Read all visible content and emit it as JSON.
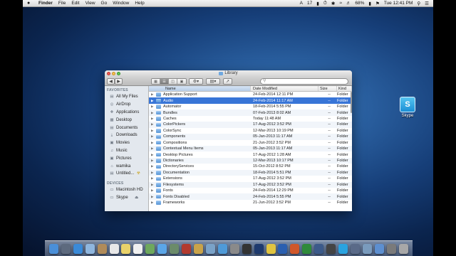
{
  "menubar": {
    "apple": "",
    "app_name": "Finder",
    "menus": [
      "File",
      "Edit",
      "View",
      "Go",
      "Window",
      "Help"
    ],
    "status": {
      "ai": "A",
      "number": "17",
      "battery": "68%",
      "clock": "Tue 12:41 PM"
    }
  },
  "window": {
    "title": "Library",
    "search_placeholder": ""
  },
  "sidebar": {
    "favorites_header": "FAVORITES",
    "favorites": [
      {
        "label": "All My Files",
        "icon": "all-files-icon"
      },
      {
        "label": "AirDrop",
        "icon": "airdrop-icon"
      },
      {
        "label": "Applications",
        "icon": "applications-icon"
      },
      {
        "label": "Desktop",
        "icon": "desktop-icon"
      },
      {
        "label": "Documents",
        "icon": "documents-icon"
      },
      {
        "label": "Downloads",
        "icon": "downloads-icon"
      },
      {
        "label": "Movies",
        "icon": "movies-icon"
      },
      {
        "label": "Music",
        "icon": "music-icon"
      },
      {
        "label": "Pictures",
        "icon": "pictures-icon"
      },
      {
        "label": "wamika",
        "icon": "home-icon"
      },
      {
        "label": "Untitled...",
        "icon": "folder-icon"
      }
    ],
    "devices_header": "DEVICES",
    "devices": [
      {
        "label": "Macintosh HD",
        "icon": "harddisk-icon"
      },
      {
        "label": "Skype",
        "icon": "disk-icon"
      }
    ]
  },
  "list": {
    "columns": {
      "name": "Name",
      "date": "Date Modified",
      "size": "Size",
      "kind": "Kind"
    },
    "rows": [
      {
        "name": "Application Support",
        "date": "24-Feb-2014 12:11 PM",
        "size": "--",
        "kind": "Folder"
      },
      {
        "name": "Audio",
        "date": "24-Feb-2014 11:17 AM",
        "size": "--",
        "kind": "Folder"
      },
      {
        "name": "Automator",
        "date": "18-Feb-2014 5:55 PM",
        "size": "--",
        "kind": "Folder"
      },
      {
        "name": "Bundles",
        "date": "07-Feb-2013 8:02 AM",
        "size": "--",
        "kind": "Folder"
      },
      {
        "name": "Caches",
        "date": "Today 11:48 AM",
        "size": "--",
        "kind": "Folder"
      },
      {
        "name": "ColorPickers",
        "date": "17-Aug-2012 3:52 PM",
        "size": "--",
        "kind": "Folder"
      },
      {
        "name": "ColorSync",
        "date": "12-Mar-2013 10:19 PM",
        "size": "--",
        "kind": "Folder"
      },
      {
        "name": "Components",
        "date": "05-Jan-2013 11:17 AM",
        "size": "--",
        "kind": "Folder"
      },
      {
        "name": "Compositions",
        "date": "21-Jun-2012 3:52 PM",
        "size": "--",
        "kind": "Folder"
      },
      {
        "name": "Contextual Menu Items",
        "date": "05-Jan-2013 11:17 AM",
        "size": "--",
        "kind": "Folder"
      },
      {
        "name": "Desktop Pictures",
        "date": "17-Aug-2012 1:28 AM",
        "size": "--",
        "kind": "Folder"
      },
      {
        "name": "Dictionaries",
        "date": "12-Mar-2013 10:17 PM",
        "size": "--",
        "kind": "Folder"
      },
      {
        "name": "DirectoryServices",
        "date": "15-Oct-2012 8:52 PM",
        "size": "--",
        "kind": "Folder"
      },
      {
        "name": "Documentation",
        "date": "18-Feb-2014 5:51 PM",
        "size": "--",
        "kind": "Folder"
      },
      {
        "name": "Extensions",
        "date": "17-Aug-2012 3:52 PM",
        "size": "--",
        "kind": "Folder"
      },
      {
        "name": "Filesystems",
        "date": "17-Aug-2012 3:52 PM",
        "size": "--",
        "kind": "Folder"
      },
      {
        "name": "Fonts",
        "date": "24-Feb-2014 12:29 PM",
        "size": "--",
        "kind": "Folder"
      },
      {
        "name": "Fonts Disabled",
        "date": "24-Feb-2014 5:55 PM",
        "size": "--",
        "kind": "Folder"
      },
      {
        "name": "Frameworks",
        "date": "21-Jun-2012 3:52 PM",
        "size": "--",
        "kind": "Folder"
      }
    ],
    "selected_index": 1
  },
  "desktop_icon": {
    "label": "Skype",
    "glyph": "S"
  },
  "dock": [
    {
      "icon": "finder-icon",
      "color": "#4a8fd8"
    },
    {
      "icon": "launchpad-icon",
      "color": "#5d6a7e"
    },
    {
      "icon": "safari-icon",
      "color": "#3a8ad8"
    },
    {
      "icon": "mail-icon",
      "color": "#8fb6de"
    },
    {
      "icon": "contacts-icon",
      "color": "#b08b5a"
    },
    {
      "icon": "calendar-icon",
      "color": "#e8e8e8"
    },
    {
      "icon": "notes-icon",
      "color": "#e9d26a"
    },
    {
      "icon": "reminders-icon",
      "color": "#f0f0f0"
    },
    {
      "icon": "maps-icon",
      "color": "#6ea85d"
    },
    {
      "icon": "messages-icon",
      "color": "#5ba6e8"
    },
    {
      "icon": "facetime-icon",
      "color": "#6b8b6a"
    },
    {
      "icon": "photo-booth-icon",
      "color": "#b23a2f"
    },
    {
      "icon": "itunes-icon",
      "color": "#c9a34a"
    },
    {
      "icon": "iphoto-icon",
      "color": "#7aa2c8"
    },
    {
      "icon": "app-store-icon",
      "color": "#4f9ad8"
    },
    {
      "icon": "system-preferences-icon",
      "color": "#8a8a8a"
    },
    {
      "icon": "dvd-player-icon",
      "color": "#333333"
    },
    {
      "icon": "photoshop-icon",
      "color": "#1e3a6e"
    },
    {
      "icon": "chrome-icon",
      "color": "#e0c440"
    },
    {
      "icon": "word-icon",
      "color": "#2a5fb0"
    },
    {
      "icon": "powerpoint-icon",
      "color": "#d0572a"
    },
    {
      "icon": "excel-icon",
      "color": "#2f8a3a"
    },
    {
      "icon": "quicktime-icon",
      "color": "#3c5a8a"
    },
    {
      "icon": "clapper-icon",
      "color": "#444444"
    },
    {
      "icon": "skype-icon",
      "color": "#2aa3e0"
    },
    {
      "icon": "bluetooth-icon",
      "color": "#5a6a88"
    },
    {
      "icon": "preview-icon",
      "color": "#7a9bbd"
    },
    {
      "icon": "folder-icon",
      "color": "#5d8fd0"
    },
    {
      "icon": "downloads-stack-icon",
      "color": "#7a7a7a"
    },
    {
      "icon": "trash-icon",
      "color": "#a8a8a8"
    }
  ]
}
